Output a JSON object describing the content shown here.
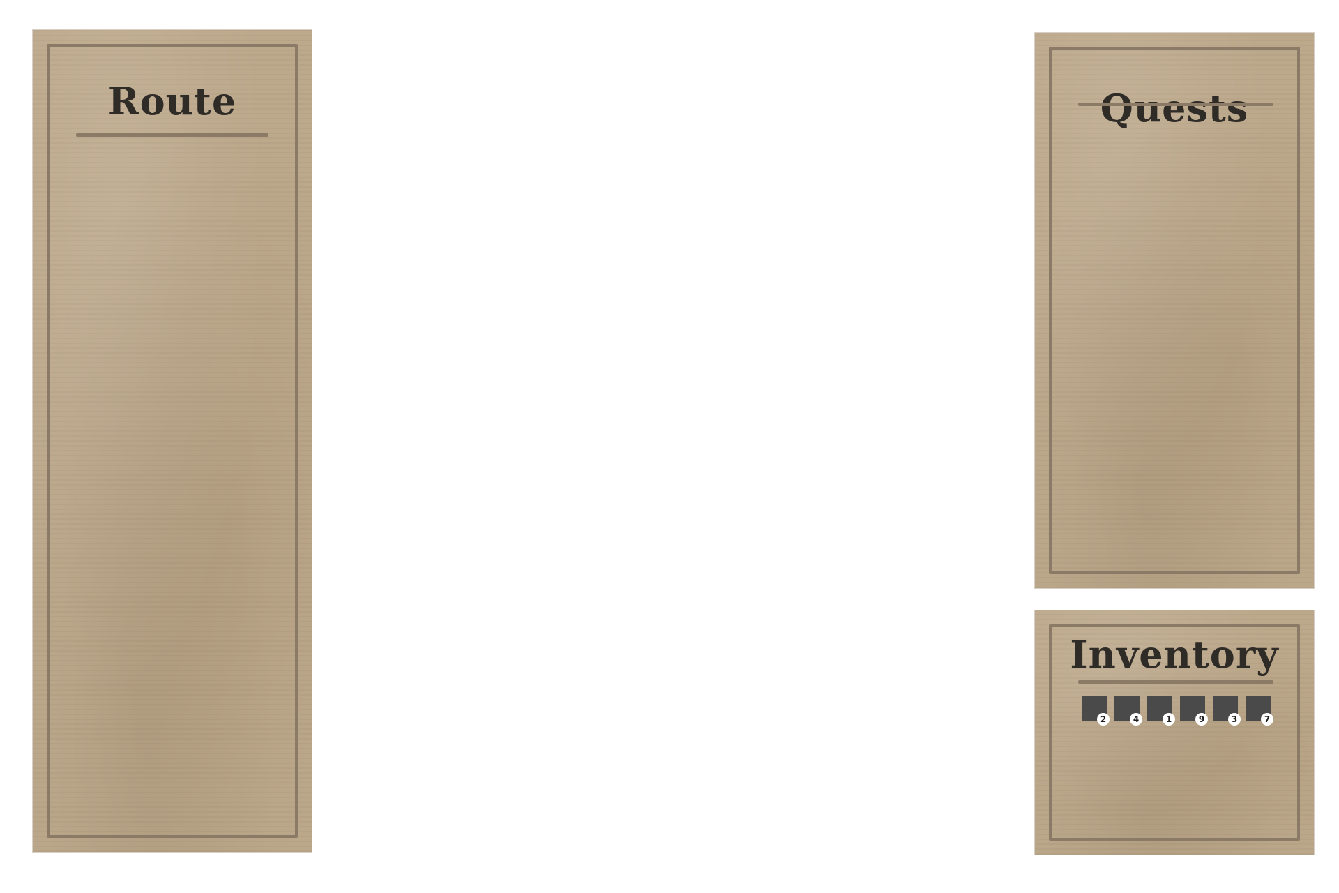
{
  "route": {
    "title": "Route"
  },
  "quests": {
    "title": "Quests"
  },
  "inventory": {
    "title": "Inventory",
    "slots": [
      {
        "count": "2"
      },
      {
        "count": "4"
      },
      {
        "count": "1"
      },
      {
        "count": "9"
      },
      {
        "count": "3"
      },
      {
        "count": "7"
      }
    ]
  },
  "colors": {
    "parchment": "#bca88b",
    "frame": "#8a7a66",
    "title_text": "#2f2b27",
    "slot": "#4a4a4a",
    "count_badge": "#ffffff"
  }
}
